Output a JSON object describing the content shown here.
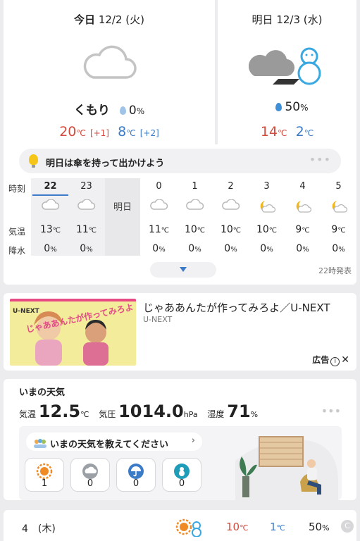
{
  "forecast": {
    "today": {
      "label": "今日",
      "date": "12/2 (火)",
      "icon": "cloud-icon",
      "condition": "くもり",
      "precip": "0",
      "precip_unit": "%",
      "high": "20",
      "high_unit": "℃",
      "high_diff": "[+1]",
      "low": "8",
      "low_unit": "℃",
      "low_diff": "[+2]"
    },
    "tomorrow": {
      "label": "明日",
      "date": "12/3 (水)",
      "icon": "cloud-snow-icon",
      "precip": "50",
      "precip_unit": "%",
      "high": "14",
      "high_unit": "℃",
      "low": "2",
      "low_unit": "℃"
    },
    "tip": "明日は傘を持って出かけよう",
    "more": "•••",
    "row_labels": {
      "time": "時刻",
      "temp": "気温",
      "precip": "降水"
    },
    "tomorrow_label": "明日",
    "hours": [
      {
        "hour": "22",
        "icon": "cloud-icon",
        "temp": "13",
        "precip": "0"
      },
      {
        "hour": "23",
        "icon": "cloud-icon",
        "temp": "11",
        "precip": "0"
      },
      {
        "hour": "0",
        "icon": "cloud-icon",
        "temp": "11",
        "precip": "0"
      },
      {
        "hour": "1",
        "icon": "cloud-icon",
        "temp": "10",
        "precip": "0"
      },
      {
        "hour": "2",
        "icon": "cloud-icon",
        "temp": "10",
        "precip": "0"
      },
      {
        "hour": "3",
        "icon": "moon-cloud-icon",
        "temp": "10",
        "precip": "0"
      },
      {
        "hour": "4",
        "icon": "moon-cloud-icon",
        "temp": "9",
        "precip": "0"
      },
      {
        "hour": "5",
        "icon": "moon-cloud-icon",
        "temp": "9",
        "precip": "0"
      }
    ],
    "temp_unit": "℃",
    "precip_unit": "%",
    "issued": "22時発表"
  },
  "ad": {
    "title": "じゃああんたが作ってみろよ／U-NEXT",
    "sponsor": "U-NEXT",
    "label": "広告",
    "info": "i",
    "close": "✕",
    "image_brand": "U-NEXT",
    "image_text": "じゃああんたが作ってみろよ"
  },
  "now": {
    "title": "いまの天気",
    "temp_label": "気温",
    "temp": "12.5",
    "temp_unit": "℃",
    "pressure_label": "気圧",
    "pressure": "1014.0",
    "pressure_unit": "hPa",
    "humidity_label": "湿度",
    "humidity": "71",
    "humidity_unit": "%",
    "more": "•••",
    "report_prompt": "いまの天気を教えてください",
    "report_chevron": "›",
    "votes": [
      {
        "icon": "sun-icon",
        "count": "1"
      },
      {
        "icon": "cloud-icon",
        "count": "0"
      },
      {
        "icon": "umbrella-icon",
        "count": "0"
      },
      {
        "icon": "snowman-icon",
        "count": "0"
      }
    ]
  },
  "next_day": {
    "date": "4　(木)",
    "icon": "sun-snow-icon",
    "high": "10",
    "low": "1",
    "unit": "℃",
    "precip": "50",
    "precip_unit": "%",
    "badge": "C"
  },
  "colors": {
    "high": "#d34a3e",
    "low": "#3b7bc8",
    "accent": "#3b7bc8",
    "moon": "#f2b71c"
  }
}
